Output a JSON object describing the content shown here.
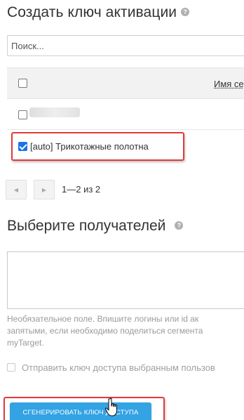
{
  "header": {
    "title": "Создать ключ активации",
    "help_glyph": "?"
  },
  "search": {
    "placeholder": "Поиск..."
  },
  "table": {
    "column_header": "Имя се",
    "rows": [
      {
        "label": "",
        "checked": false,
        "blurred": true
      },
      {
        "label": "[auto] Трикотажные полотна",
        "checked": true
      }
    ]
  },
  "pagination": {
    "prev_glyph": "◀",
    "next_glyph": "▶",
    "info": "1—2 из 2"
  },
  "recipients": {
    "title": "Выберите получателей",
    "help_glyph": "?",
    "hint_lines": [
      "Необязательное поле. Впишите логины или id ак",
      "запятыми, если необходимо поделиться сегмента",
      "myTarget."
    ]
  },
  "send_option": {
    "label": "Отправить ключ доступа выбранным пользов",
    "checked": false
  },
  "generate_button": {
    "label": "СГЕНЕРИРОВАТЬ КЛЮЧ ДОСТУПА"
  },
  "colors": {
    "accent": "#33a3e3",
    "highlight": "#e23b3b",
    "checkbox": "#1a73e8"
  }
}
